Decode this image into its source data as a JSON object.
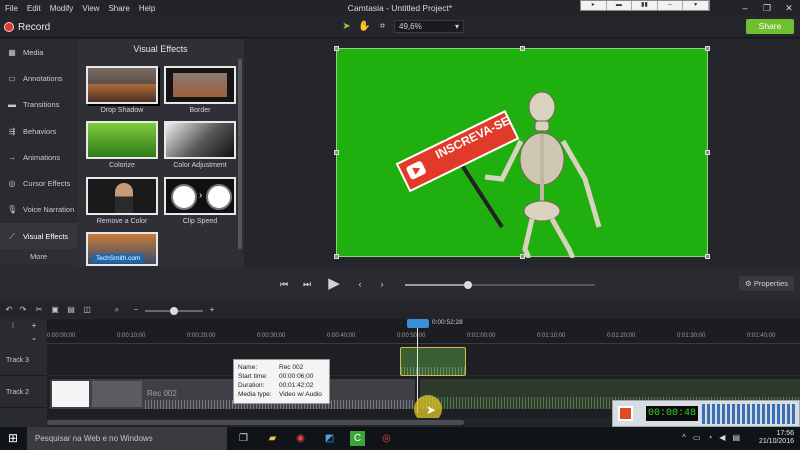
{
  "menu": [
    "File",
    "Edit",
    "Modify",
    "View",
    "Share",
    "Help"
  ],
  "app_title": "Camtasia - Untitled Project*",
  "window_controls": [
    "–",
    "❐",
    "✕"
  ],
  "toolbar": {
    "record_label": "Record",
    "zoom_value": "49,6%",
    "share_label": "Share"
  },
  "sidebar": {
    "items": [
      {
        "label": "Media",
        "icon": "film-icon"
      },
      {
        "label": "Annotations",
        "icon": "annotation-icon"
      },
      {
        "label": "Transitions",
        "icon": "transition-icon"
      },
      {
        "label": "Behaviors",
        "icon": "behavior-icon"
      },
      {
        "label": "Animations",
        "icon": "animation-icon"
      },
      {
        "label": "Cursor Effects",
        "icon": "cursor-icon"
      },
      {
        "label": "Voice Narration",
        "icon": "microphone-icon"
      },
      {
        "label": "Visual Effects",
        "icon": "wand-icon"
      }
    ],
    "more_label": "More"
  },
  "vfx": {
    "title": "Visual Effects",
    "items": [
      {
        "label": "Drop Shadow"
      },
      {
        "label": "Border"
      },
      {
        "label": "Colorize"
      },
      {
        "label": "Color Adjustment"
      },
      {
        "label": "Remove a Color"
      },
      {
        "label": "Clip Speed"
      },
      {
        "label": "",
        "watermark": "TechSmith.com"
      }
    ]
  },
  "canvas": {
    "sign_text": "INSCREVA-SE",
    "bg_color": "#1fb00f"
  },
  "playback": {
    "properties_label": "Properties"
  },
  "timeline": {
    "playhead_time": "0:00:52;28",
    "ruler_ticks": [
      "0:00:00;00",
      "0:00:10;00",
      "0:00:20;00",
      "0:00:30;00",
      "0:00:40;00",
      "0:00:50;00",
      "0:01:00;00",
      "0:01:10;00",
      "0:01:20;00",
      "0:01:30;00",
      "0:01:40;00"
    ],
    "tracks": [
      {
        "label": "Track 3"
      },
      {
        "label": "Track 2"
      }
    ],
    "clip_label": "Rec 002"
  },
  "tooltip": {
    "rows": [
      {
        "k": "Name:",
        "v": "Rec 002"
      },
      {
        "k": "Start time:",
        "v": "00:00:06;00"
      },
      {
        "k": "Duration:",
        "v": "00:01:42;02"
      },
      {
        "k": "Media type:",
        "v": "Video w/ Audio"
      }
    ]
  },
  "recorder": {
    "timer": "00:00:48"
  },
  "taskbar": {
    "search_placeholder": "Pesquisar na Web e no Windows",
    "time": "17:56",
    "date": "21/10/2016"
  }
}
